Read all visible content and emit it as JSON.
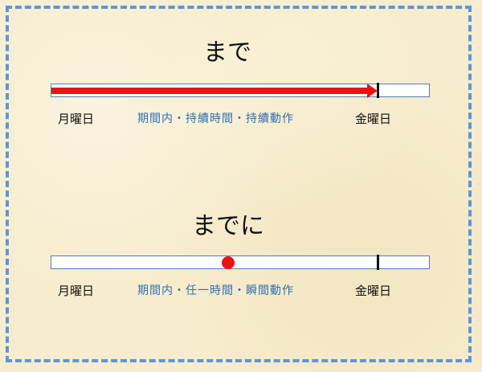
{
  "colors": {
    "background": "#f7eccd",
    "frame_border": "#5b97d8",
    "duration_arrow": "#ee1111",
    "point_marker": "#ee1111",
    "middle_text": "#2f6fb5"
  },
  "top_section": {
    "title": "まで",
    "start_label": "月曜日",
    "middle_label": "期間内・持續時間・持續動作",
    "end_label": "金曜日"
  },
  "bottom_section": {
    "title": "までに",
    "start_label": "月曜日",
    "middle_label": "期間内・任一時間・瞬間動作",
    "end_label": "金曜日"
  }
}
